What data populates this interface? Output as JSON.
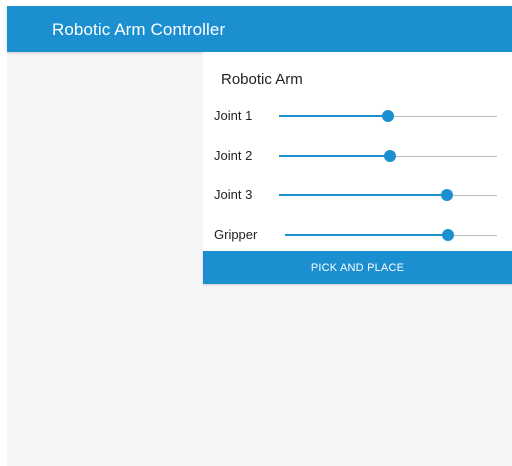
{
  "app_bar": {
    "title": "Robotic Arm Controller"
  },
  "card": {
    "title": "Robotic Arm",
    "sliders": [
      {
        "label": "Joint 1",
        "value_fraction": 0.5
      },
      {
        "label": "Joint 2",
        "value_fraction": 0.51
      },
      {
        "label": "Joint 3",
        "value_fraction": 0.77
      },
      {
        "label": "Gripper",
        "value_fraction": 0.77
      }
    ],
    "action_button": {
      "label": "PICK AND PLACE"
    }
  },
  "colors": {
    "accent": "#1c8fd0",
    "rail": "#bdbdbd",
    "background": "#f6f6f6",
    "card_background": "#ffffff",
    "text": "#222222"
  }
}
